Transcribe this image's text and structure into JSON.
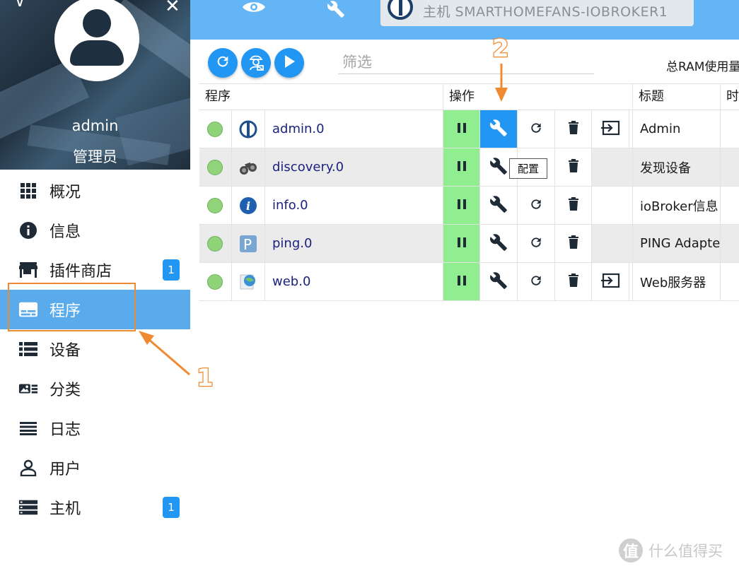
{
  "sidebar": {
    "username": "admin",
    "role": "管理员",
    "items": [
      {
        "label": "概况",
        "icon": "dashboard-grid-icon",
        "badge": ""
      },
      {
        "label": "信息",
        "icon": "info-icon",
        "badge": ""
      },
      {
        "label": "插件商店",
        "icon": "store-icon",
        "badge": "1"
      },
      {
        "label": "程序",
        "icon": "instances-icon",
        "badge": "",
        "active": true
      },
      {
        "label": "设备",
        "icon": "devices-list-icon",
        "badge": ""
      },
      {
        "label": "分类",
        "icon": "categories-icon",
        "badge": ""
      },
      {
        "label": "日志",
        "icon": "log-icon",
        "badge": ""
      },
      {
        "label": "用户",
        "icon": "user-icon",
        "badge": ""
      },
      {
        "label": "主机",
        "icon": "hosts-icon",
        "badge": "1"
      }
    ]
  },
  "topbar": {
    "host": "主机 SMARTHOMEFANS-IOBROKER1",
    "icons": [
      "eye-icon",
      "wrench-icon"
    ]
  },
  "toolbar": {
    "filter_placeholder": "筛选",
    "ram_label": "总RAM使用量"
  },
  "table": {
    "headers": {
      "program": "程序",
      "actions": "操作",
      "title": "标题",
      "time": "时"
    },
    "rows": [
      {
        "name": "admin.0",
        "title": "Admin",
        "icon": "admin-logo-icon",
        "has_restart": true,
        "has_link": true
      },
      {
        "name": "discovery.0",
        "title": "发现设备",
        "icon": "binoculars-icon",
        "has_restart": false,
        "has_link": false
      },
      {
        "name": "info.0",
        "title": "ioBroker信息",
        "icon": "info-logo-icon",
        "has_restart": true,
        "has_link": false
      },
      {
        "name": "ping.0",
        "title": "PING Adapte",
        "icon": "ping-logo-icon",
        "has_restart": true,
        "has_link": false
      },
      {
        "name": "web.0",
        "title": "Web服务器",
        "icon": "web-logo-icon",
        "has_restart": true,
        "has_link": true
      }
    ],
    "tooltip": "配置"
  },
  "annotations": {
    "step1": "1",
    "step2": "2"
  },
  "watermark": "什么值得买",
  "colors": {
    "topbar": "#64b5f6",
    "active_menu": "#5aabec",
    "primary": "#2196f3",
    "pause_bg": "#90ee90",
    "annotation": "#f08a32"
  }
}
